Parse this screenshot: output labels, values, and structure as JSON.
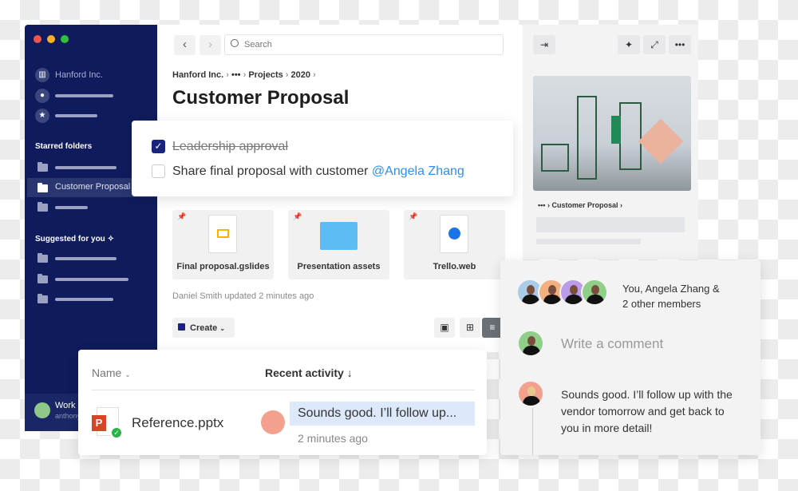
{
  "sidebar": {
    "org": "Hanford Inc.",
    "starred_heading": "Starred folders",
    "selected_folder": "Customer Proposal",
    "suggested_heading": "Suggested for you",
    "footer_name": "Work",
    "footer_sub": "anthony"
  },
  "toolbar": {
    "back": "‹",
    "forward": "›",
    "search_placeholder": "Search"
  },
  "breadcrumb": {
    "items": [
      "Hanford Inc.",
      "•••",
      "Projects",
      "2020"
    ]
  },
  "page_title": "Customer Proposal",
  "checklist": [
    {
      "text": "Leadership approval",
      "checked": true
    },
    {
      "text": "Share final proposal with customer",
      "mention": "@Angela Zhang",
      "checked": false
    }
  ],
  "files": [
    {
      "name": "Final proposal.gslides",
      "icon": "slides-icon"
    },
    {
      "name": "Presentation assets",
      "icon": "folder-icon"
    },
    {
      "name": "Trello.web",
      "icon": "web-link-icon"
    }
  ],
  "updated": "Daniel Smith updated 2 minutes ago",
  "create_label": "Create",
  "table": {
    "col_name": "Name",
    "col_activity": "Recent activity",
    "row": {
      "file": "Reference.pptx",
      "comment": "Sounds good. I’ll follow up...",
      "time": "2 minutes ago"
    }
  },
  "preview": {
    "breadcrumb_more": "•••",
    "breadcrumb_item": "Customer Proposal"
  },
  "comments": {
    "members": "You, Angela Zhang &",
    "members2": "2 other members",
    "placeholder": "Write a comment",
    "comment": "Sounds good. I’ll follow up with the vendor tomorrow and get back to you in more detail!"
  },
  "colors": {
    "sidebar": "#0f1b5c",
    "accent": "#1a73e8",
    "mention": "#2f8ff0"
  }
}
